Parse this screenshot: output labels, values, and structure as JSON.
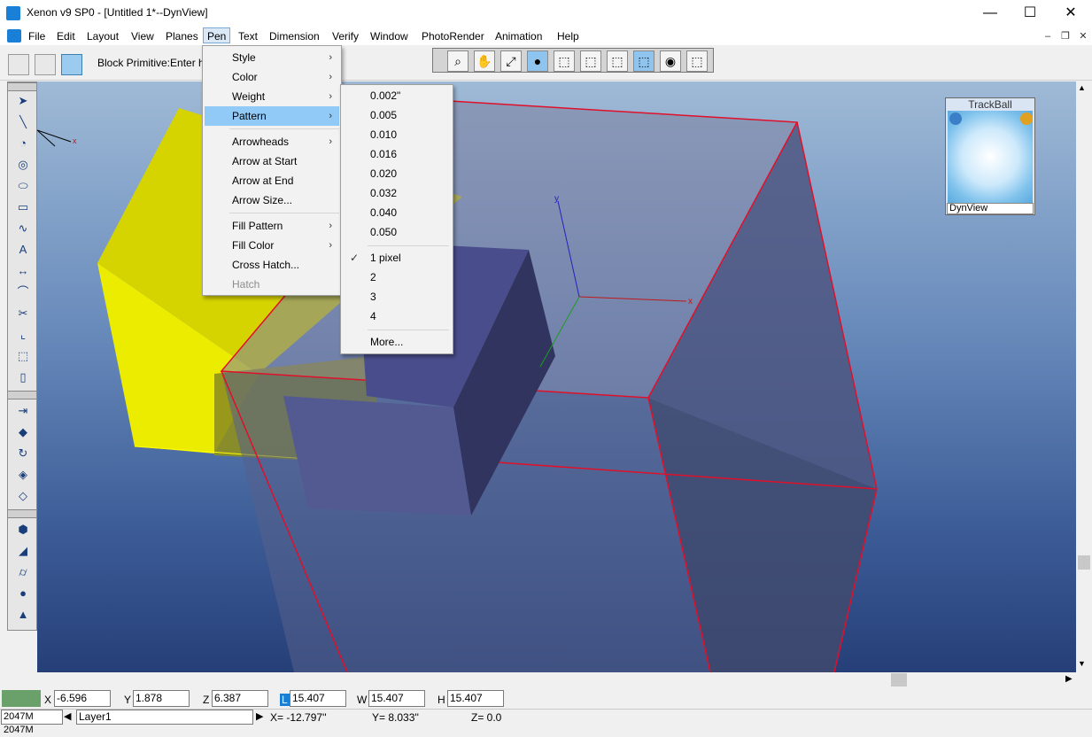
{
  "window": {
    "title": "Xenon v9 SP0 - [Untitled 1*--DynView]",
    "minimize": "—",
    "maximize": "☐",
    "close": "✕"
  },
  "menubar": {
    "items": [
      "File",
      "Edit",
      "Layout",
      "View",
      "Planes",
      "Pen",
      "Text",
      "Dimension",
      "Verify",
      "Window",
      "PhotoRender",
      "Animation",
      "Help"
    ],
    "active": "Pen",
    "mdi_minimize": "–",
    "mdi_restore": "❐",
    "mdi_close": "✕"
  },
  "toolbar": {
    "prompt": "Block Primitive:Enter heig"
  },
  "pen_menu": {
    "items": [
      {
        "label": "Style",
        "submenu": true
      },
      {
        "label": "Color",
        "submenu": true
      },
      {
        "label": "Weight",
        "submenu": true
      },
      {
        "label": "Pattern",
        "submenu": true
      },
      {
        "label": "Arrowheads",
        "submenu": true
      },
      {
        "label": "Arrow at Start",
        "submenu": false
      },
      {
        "label": "Arrow at End",
        "submenu": false
      },
      {
        "label": "Arrow Size...",
        "submenu": false
      },
      {
        "label": "Fill Pattern",
        "submenu": true
      },
      {
        "label": "Fill Color",
        "submenu": true
      },
      {
        "label": "Cross Hatch...",
        "submenu": false
      },
      {
        "label": "Hatch",
        "submenu": false
      }
    ]
  },
  "pattern_submenu": {
    "items": [
      "0.002\"",
      "0.005",
      "0.010",
      "0.016",
      "0.020",
      "0.032",
      "0.040",
      "0.050",
      "1 pixel",
      "2",
      "3",
      "4",
      "More..."
    ],
    "checked": "1 pixel",
    "check_mark": "✓"
  },
  "trackball": {
    "title": "TrackBall",
    "view": "DynView"
  },
  "viewport": {
    "axis_x": "x",
    "axis_y": "y",
    "corner_axis_x": "x"
  },
  "coords": {
    "x_label": "X",
    "x_value": "-6.596",
    "y_label": "Y",
    "y_value": "1.878",
    "z_label": "Z",
    "z_value": "6.387",
    "l_label": "L",
    "l_value": "15.407",
    "w_label": "W",
    "w_value": "15.407",
    "h_label": "H",
    "h_value": "15.407"
  },
  "status": {
    "memory": "2047M 2047M",
    "layer": "Layer1",
    "x_readout": "X=   -12.797''",
    "y_readout": "Y=    8.033''",
    "z_readout": "Z=      0.0"
  }
}
